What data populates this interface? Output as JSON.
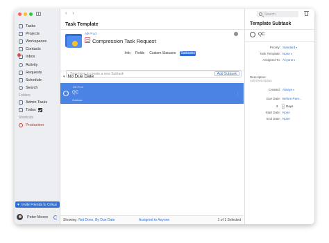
{
  "sidebar": {
    "nav": [
      "Tasks",
      "Projects",
      "Workspaces",
      "Contacts",
      "Inbox",
      "Activity",
      "Requests",
      "Schedule",
      "Search"
    ],
    "folders_label": "Folders",
    "folders": [
      "Admin Tasks",
      "Todos"
    ],
    "shortcuts_label": "Shortcuts",
    "shortcuts": [
      "Production"
    ],
    "invite": "Invite Friends to Cirkus",
    "user_name": "Peter Moore"
  },
  "main": {
    "title": "Task Template",
    "list_link": "Alli Prod",
    "task_name": "Compression Task Request",
    "tabs": [
      {
        "label": "Info",
        "active": false
      },
      {
        "label": "Fields",
        "active": false
      },
      {
        "label": "Custom Statuses",
        "active": false
      },
      {
        "label": "Subtasks",
        "active": true
      }
    ],
    "subtask_placeholder": "Type here to create a new Subtask",
    "add_subtask": "Add Subtask",
    "group": "No Due Date",
    "task": {
      "list": "Alli Prod",
      "title": "QC",
      "meta": "Subtask"
    },
    "status_bar": {
      "showing": "Showing",
      "filter": "Not Done, By Due Date",
      "assigned": "Assigned to Anyone",
      "count": "1 of 1 Selected"
    }
  },
  "detail": {
    "search_placeholder": "Search",
    "title": "Template Subtask",
    "task": "QC",
    "fields": [
      {
        "label": "Priority:",
        "value": "Standard"
      },
      {
        "label": "Task Template:",
        "value": "None"
      },
      {
        "label": "Assigned To:",
        "value": "Anyone"
      }
    ],
    "description_label": "Description:",
    "description_placeholder": "Add Description",
    "created_label": "Created:",
    "created_value": "Always",
    "due_label": "Due Date:",
    "due_value": "Before Pare...",
    "days_value": "3",
    "days_label": "Days",
    "start_label": "Start Date:",
    "start_value": "None",
    "end_label": "End Date:",
    "end_value": "None"
  },
  "colors": {
    "accent": "#2f6fd6",
    "selected_row": "#4a83e3",
    "production": "#d93025"
  }
}
